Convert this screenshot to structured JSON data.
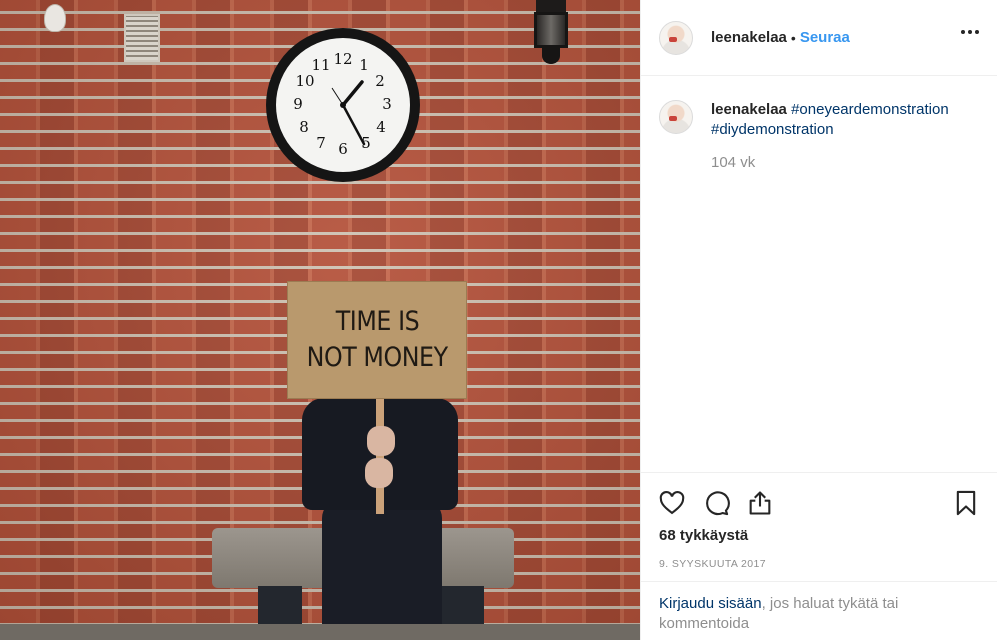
{
  "post": {
    "username": "leenakelaa",
    "follow_label": "Seuraa",
    "dot": "•",
    "sign_line1": "TIME IS",
    "sign_line2": "NOT MONEY",
    "caption_user": "leenakelaa",
    "hashtag1": "#oneyeardemonstration",
    "hashtag2": "#diydemonstration",
    "time_ago": "104 vk",
    "likes": "68 tykkäystä",
    "date": "9. SYYSKUUTA 2017",
    "login_link": "Kirjaudu sisään",
    "login_rest": ", jos haluat tykätä tai kommentoida"
  },
  "icons": {
    "like": "heart-icon",
    "comment": "comment-icon",
    "share": "share-icon",
    "save": "bookmark-icon",
    "more": "more-options-icon"
  },
  "colors": {
    "link_blue": "#3897f0",
    "hashtag": "#003569",
    "secondary_text": "#8e8e8e",
    "text": "#262626",
    "divider": "#efefef"
  }
}
